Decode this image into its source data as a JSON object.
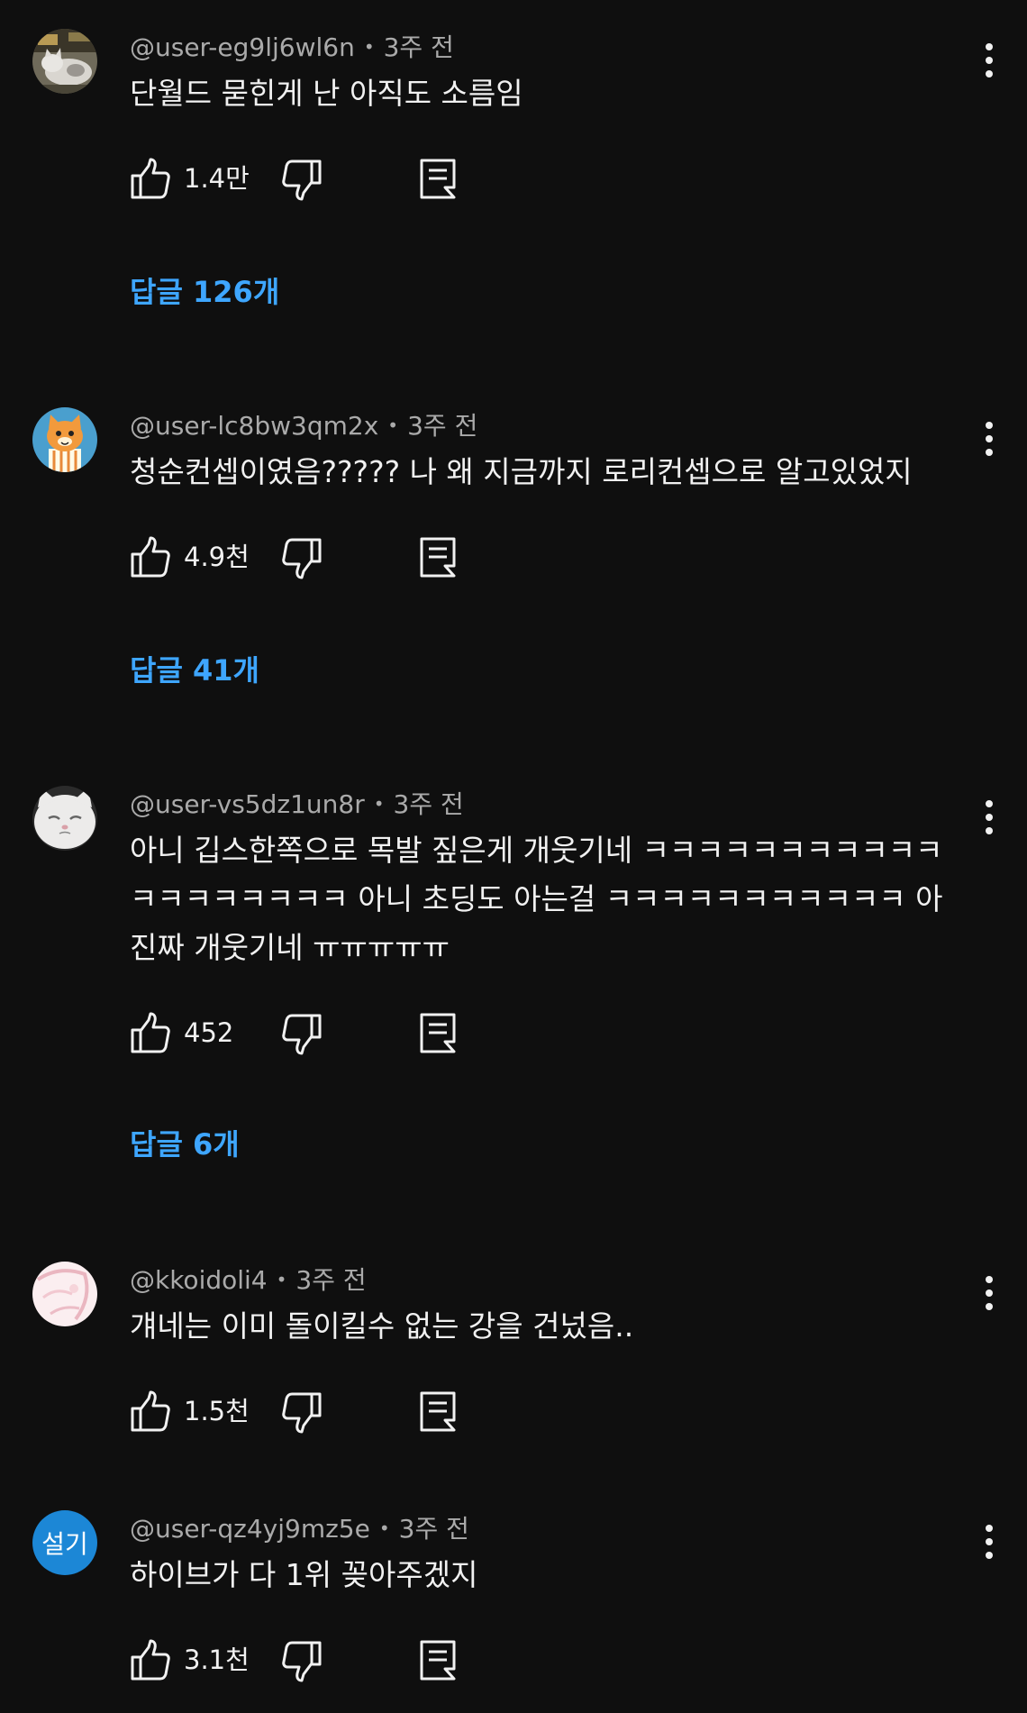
{
  "colors": {
    "background": "#0f0f0f",
    "text": "#f1f1f1",
    "meta": "#aaaaaa",
    "link": "#3ea6ff",
    "avatar_blue": "#1c87d6"
  },
  "icons": {
    "like": "thumbs-up-icon",
    "dislike": "thumbs-down-icon",
    "reply": "comment-icon",
    "more": "more-vertical-icon"
  },
  "comments": [
    {
      "username": "@user-eg9lj6wl6n",
      "time": "3주 전",
      "text": "단월드 묻힌게 난 아직도 소름임",
      "likes": "1.4만",
      "replies": "답글 126개"
    },
    {
      "username": "@user-lc8bw3qm2x",
      "time": "3주 전",
      "text": "청순컨셉이였음????? 나 왜 지금까지 로리컨셉으로 알고있었지",
      "likes": "4.9천",
      "replies": "답글 41개"
    },
    {
      "username": "@user-vs5dz1un8r",
      "time": "3주 전",
      "text": "아니 깁스한쪽으로 목발 짚은게 개웃기네 ㅋㅋㅋㅋㅋㅋㅋㅋㅋㅋㅋㅋㅋㅋㅋㅋㅋㅋㅋ 아니 초딩도 아는걸 ㅋㅋㅋㅋㅋㅋㅋㅋㅋㅋㅋ 아 진짜 개웃기네 ㅠㅠㅠㅠㅠ",
      "likes": "452",
      "replies": "답글 6개"
    },
    {
      "username": "@kkoidoli4",
      "time": "3주 전",
      "text": "걔네는 이미 돌이킬수 없는 강을 건넜음..",
      "likes": "1.5천"
    },
    {
      "username": "@user-qz4yj9mz5e",
      "time": "3주 전",
      "text": "하이브가 다 1위 꽂아주겠지",
      "likes": "3.1천",
      "avatar_text": "설기"
    }
  ]
}
